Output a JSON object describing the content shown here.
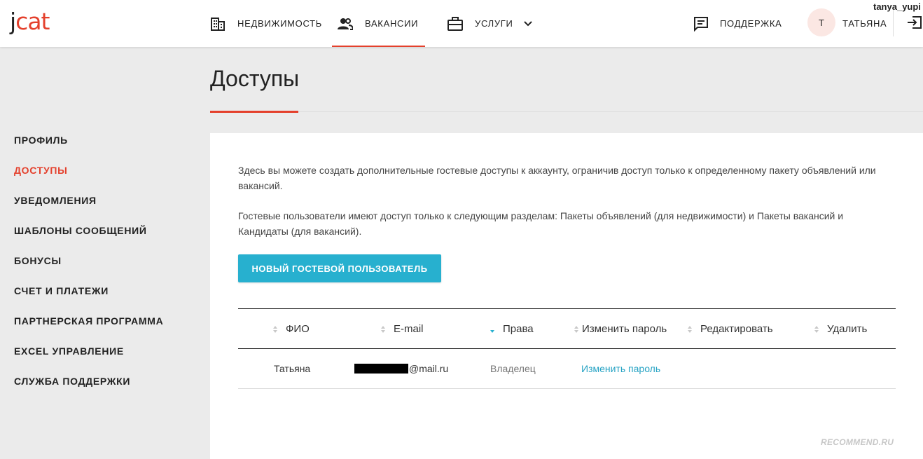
{
  "header": {
    "logo_prefix": "j",
    "logo_rest": "cat",
    "nav": [
      {
        "label": "НЕДВИЖИМОСТЬ",
        "icon": "building-icon"
      },
      {
        "label": "ВАКАНСИИ",
        "icon": "people-icon"
      },
      {
        "label": "УСЛУГИ",
        "icon": "briefcase-icon"
      }
    ],
    "support_label": "ПОДДЕРЖКА",
    "avatar_initial": "Т",
    "user_name": "ТАТЬЯНА",
    "accent_color": "#e4402c"
  },
  "watermark_user": "tanya_yupi",
  "page_title": "Доступы",
  "sidebar": {
    "items": [
      {
        "label": "ПРОФИЛЬ"
      },
      {
        "label": "ДОСТУПЫ"
      },
      {
        "label": "УВЕДОМЛЕНИЯ"
      },
      {
        "label": "ШАБЛОНЫ СООБЩЕНИЙ"
      },
      {
        "label": "БОНУСЫ"
      },
      {
        "label": "СЧЕТ И ПЛАТЕЖИ"
      },
      {
        "label": "ПАРТНЕРСКАЯ ПРОГРАММА"
      },
      {
        "label": "EXCEL УПРАВЛЕНИЕ"
      },
      {
        "label": "СЛУЖБА ПОДДЕРЖКИ"
      }
    ],
    "active": "ДОСТУПЫ"
  },
  "content": {
    "paragraph1": "Здесь вы можете создать дополнительные гостевые доступы к аккаунту, ограничив доступ только к определенному пакету объявлений или вакансий.",
    "paragraph2": "Гостевые пользователи имеют доступ только к следующим разделам: Пакеты объявлений (для недвижимости) и Пакеты вакансий и Кандидаты (для вакансий).",
    "new_user_button": "НОВЫЙ ГОСТЕВОЙ ПОЛЬЗОВАТЕЛЬ",
    "button_color": "#27b0cf"
  },
  "table": {
    "columns": [
      "ФИО",
      "E-mail",
      "Права",
      "Изменить пароль",
      "Редактировать",
      "Удалить"
    ],
    "rows": [
      {
        "name": "Татьяна",
        "email_visible": "@mail.ru",
        "rights": "Владелец",
        "change_password": "Изменить пароль"
      }
    ]
  },
  "footer_watermark": "RECOMMEND.RU"
}
